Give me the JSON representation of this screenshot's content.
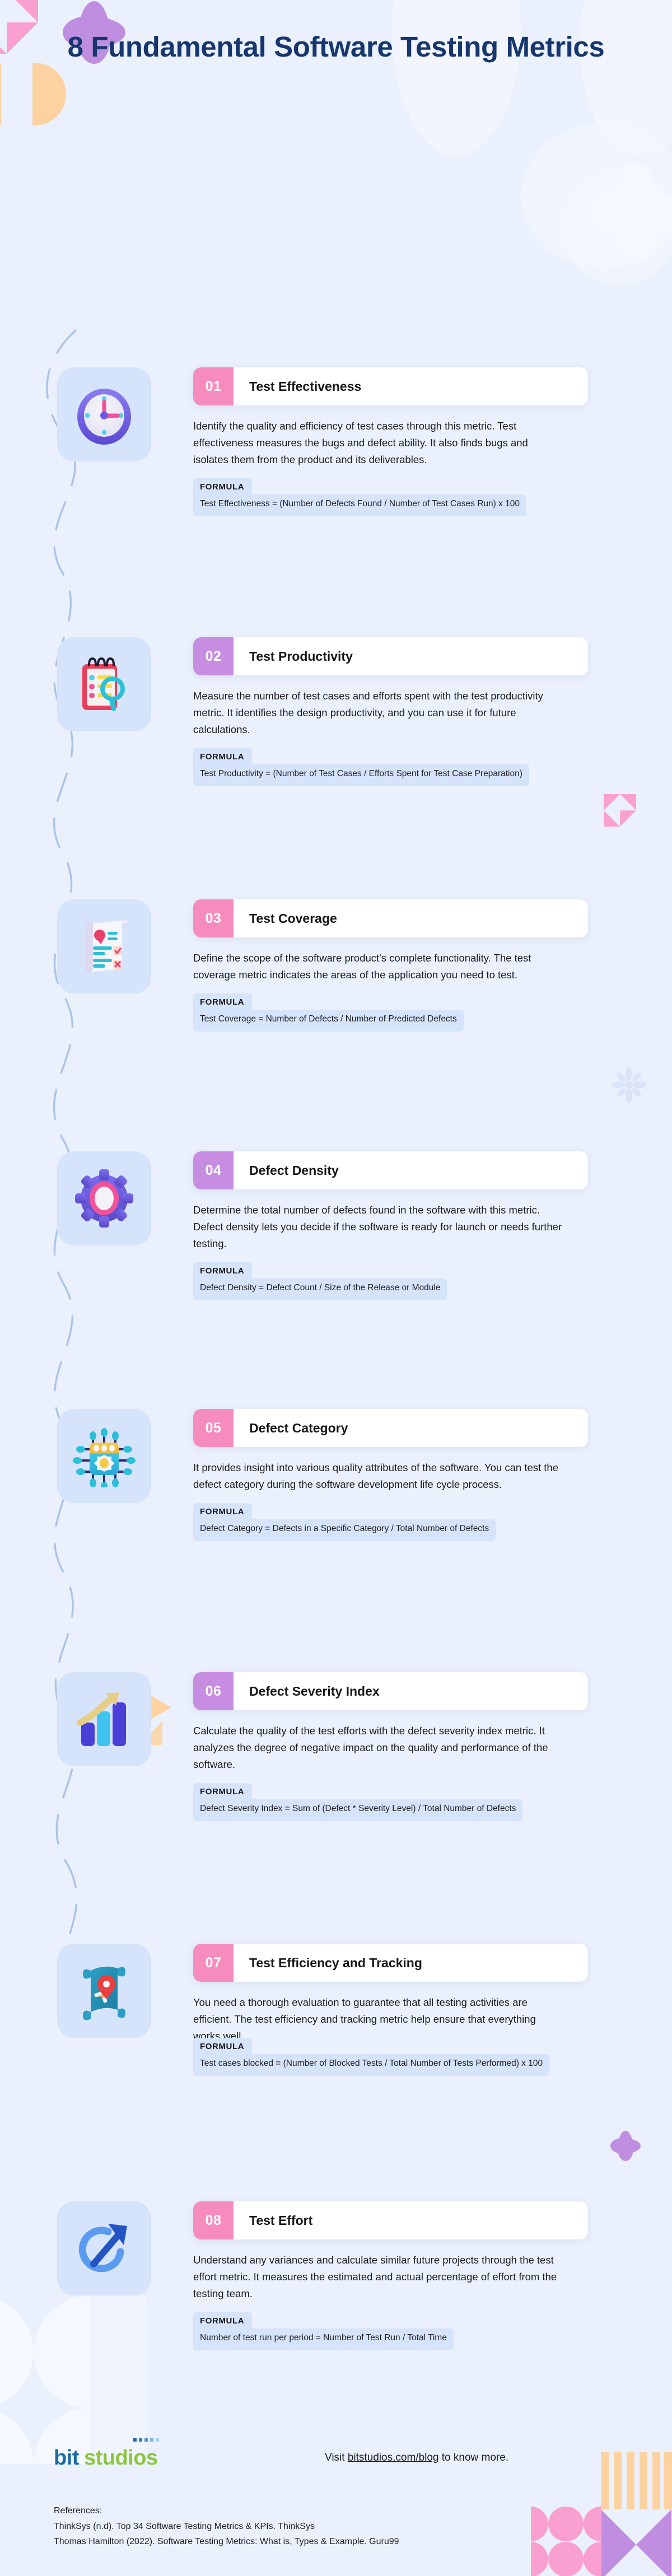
{
  "header": {
    "title": "8 Fundamental Software Testing Metrics"
  },
  "formula_label": "FORMULA",
  "metrics": [
    {
      "number": "01",
      "title": "Test Effectiveness",
      "description": "Identify the quality and efficiency of test cases through this metric. Test effectiveness measures the bugs and defect ability. It also finds bugs and isolates them from the product and its deliverables.",
      "formula": "Test Effectiveness = (Number of Defects Found / Number of Test Cases Run) x 100",
      "badge_color": "#f68bbd",
      "icon": "clock-icon"
    },
    {
      "number": "02",
      "title": "Test Productivity",
      "description": "Measure the number of test cases and efforts spent with the test productivity metric. It identifies the design productivity, and you can use it for future calculations.",
      "formula": "Test Productivity = (Number of Test Cases / Efforts Spent for Test Case Preparation)",
      "badge_color": "#c78de0",
      "icon": "notepad-magnifier-icon"
    },
    {
      "number": "03",
      "title": "Test Coverage",
      "description": "Define the scope of the software product's complete functionality. The test coverage metric indicates the areas of the application you need to test.",
      "formula": "Test Coverage = Number of Defects / Number of Predicted Defects",
      "badge_color": "#f68bbd",
      "icon": "checklist-document-icon"
    },
    {
      "number": "04",
      "title": "Defect Density",
      "description": "Determine the total number of defects found in the software with this metric. Defect density lets you decide if the software is ready for launch or needs further testing.",
      "formula": "Defect Density = Defect Count / Size of the Release or Module",
      "badge_color": "#c78de0",
      "icon": "gear-icon"
    },
    {
      "number": "05",
      "title": "Defect Category",
      "description": "It provides insight into various quality attributes of the software. You can test the defect category during the software development life cycle process.",
      "formula": "Defect Category = Defects in a Specific Category / Total Number of Defects",
      "badge_color": "#f68bbd",
      "icon": "microchip-icon"
    },
    {
      "number": "06",
      "title": "Defect Severity Index",
      "description": "Calculate the quality of the test efforts with the defect severity index metric. It analyzes the degree of negative impact on the quality and performance of the software.",
      "formula": "Defect Severity Index = Sum of (Defect * Severity Level) / Total Number of Defects",
      "badge_color": "#c78de0",
      "icon": "bar-chart-growth-icon"
    },
    {
      "number": "07",
      "title": "Test Efficiency and Tracking",
      "description": "You need a thorough evaluation to guarantee that all testing activities are efficient. The test efficiency and tracking metric help ensure that everything works well.",
      "formula": "Test cases blocked = (Number of Blocked Tests / Total Number of Tests Performed) x 100",
      "badge_color": "#f68bbd",
      "icon": "map-pin-icon"
    },
    {
      "number": "08",
      "title": "Test Effort",
      "description": "Understand any variances and calculate similar future projects through the test effort metric. It measures the estimated and actual percentage of effort from the testing team.",
      "formula": "Number of test run per period = Number of Test Run / Total Time",
      "badge_color": "#f68bbd",
      "icon": "refresh-arrow-icon"
    }
  ],
  "footer": {
    "logo_bit": "bit",
    "logo_studios": "studios",
    "visit_prefix": "Visit ",
    "visit_link": "bitstudios.com/blog",
    "visit_suffix": " to know more.",
    "references_heading": "References:",
    "references": [
      "ThinkSys (n.d). Top 34 Software Testing Metrics & KPIs. ThinkSys",
      "Thomas Hamilton (2022). Software Testing Metrics: What is, Types & Example. Guru99"
    ]
  },
  "colors": {
    "page_bg": "#eaf0fc",
    "title_navy": "#16366e",
    "badge_pink": "#f68bbd",
    "badge_purple": "#c78de0",
    "tile_blue": "#d6e4fb",
    "formula_bg": "#d6e4fb",
    "logo_blue": "#1a6aa6",
    "logo_green": "#8cc63f"
  }
}
